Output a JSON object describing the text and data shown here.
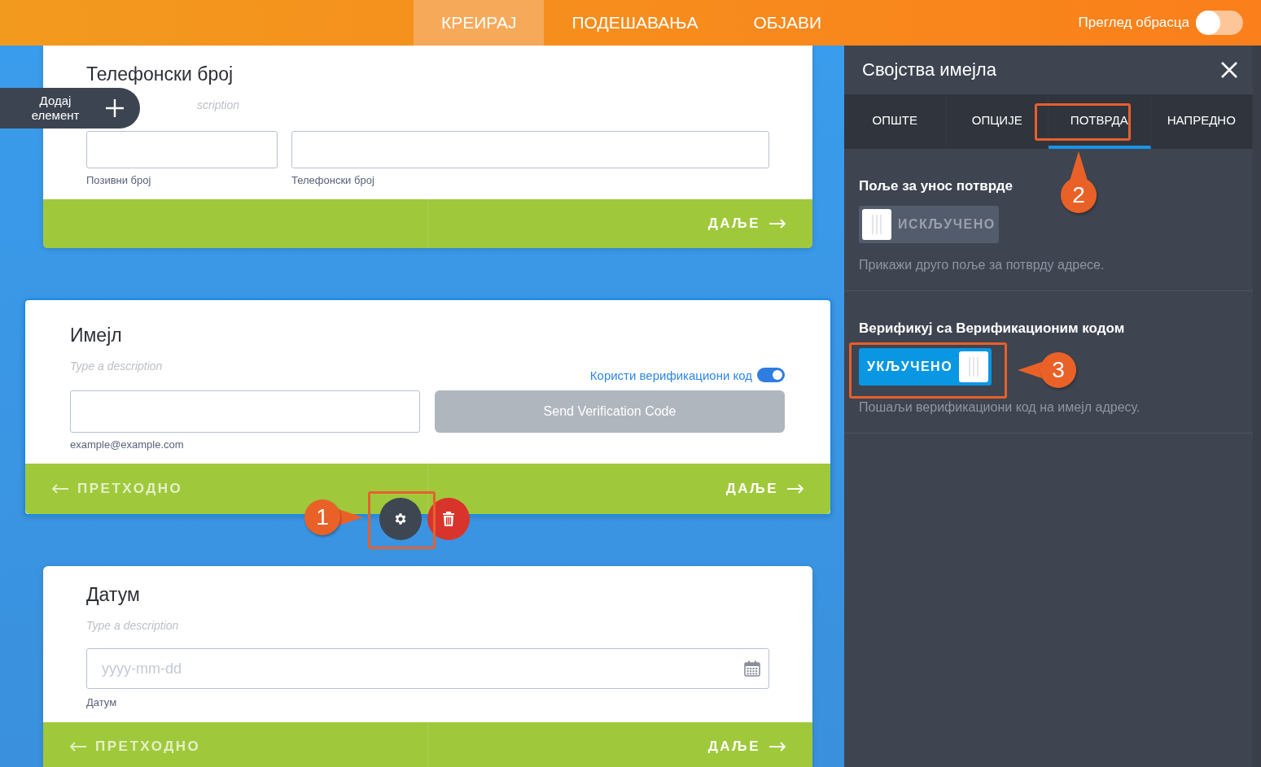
{
  "top_bar": {
    "tabs": [
      {
        "label": "КРЕИРАЈ",
        "selected": true
      },
      {
        "label": "ПОДЕШАВАЊА",
        "selected": false
      },
      {
        "label": "ОБЈАВИ",
        "selected": false
      }
    ],
    "preview": {
      "label": "Преглед обрасца",
      "on": false
    }
  },
  "add_element": {
    "label": "Додај елемент"
  },
  "form_cards": [
    {
      "kind": "phone",
      "title": "Телефонски број",
      "description": "scription",
      "selected": false,
      "fields": [
        {
          "label": "Позивни број"
        },
        {
          "label": "Телефонски број"
        }
      ],
      "next": "ДАЉЕ"
    },
    {
      "kind": "email",
      "title": "Имејл",
      "description": "Type a description",
      "selected": true,
      "verification": {
        "label": "Користи верификациони код",
        "on": true
      },
      "button": {
        "label": "Send Verification Code",
        "disabled": true
      },
      "fields": [
        {
          "label": "example@example.com"
        }
      ],
      "previous": "ПРЕТХОДНО",
      "next": "ДАЉЕ"
    },
    {
      "kind": "date",
      "title": "Датум",
      "description": "Type a description",
      "selected": false,
      "fields": [
        {
          "label": "Датум",
          "placeholder": "yyyy-mm-dd"
        }
      ],
      "previous": "ПРЕТХОДНО",
      "next": "ДАЉЕ"
    }
  ],
  "properties_panel": {
    "title": "Својства имејла",
    "tabs": [
      {
        "label": "ОПШТЕ",
        "selected": false
      },
      {
        "label": "ОПЦИЈЕ",
        "selected": false
      },
      {
        "label": "ПОТВРДА",
        "selected": true
      },
      {
        "label": "НАПРЕДНО",
        "selected": false
      }
    ],
    "settings": [
      {
        "title": "Поље за унос потврде",
        "toggle": {
          "on": false,
          "label": "ИСКЉУЧЕНО"
        },
        "description": "Прикажи друго поље за потврду адресе."
      },
      {
        "title": "Верификуј са Верификационим кодом",
        "toggle": {
          "on": true,
          "label": "УКЉУЧЕНО"
        },
        "description": "Пошаљи верификациони код на имејл адресу."
      }
    ]
  },
  "callouts": [
    {
      "number": "1"
    },
    {
      "number": "2"
    },
    {
      "number": "3"
    }
  ]
}
